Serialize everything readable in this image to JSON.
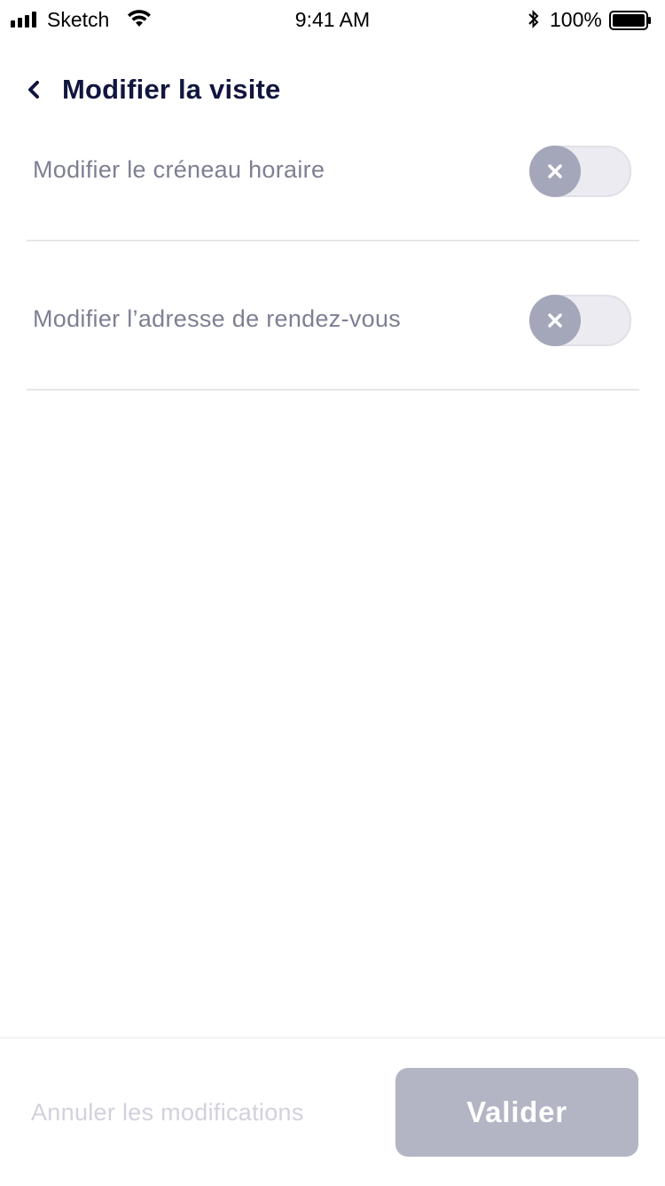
{
  "status_bar": {
    "carrier": "Sketch",
    "time": "9:41 AM",
    "battery_percent": "100%",
    "icons": [
      "signal-icon",
      "wifi-icon",
      "bluetooth-icon",
      "battery-icon"
    ]
  },
  "header": {
    "back_icon": "chevron-left-icon",
    "title": "Modifier la visite"
  },
  "options": [
    {
      "label": "Modifier le créneau horaire",
      "enabled": false,
      "toggle_icon": "close-icon"
    },
    {
      "label": "Modifier l’adresse de rendez-vous",
      "enabled": false,
      "toggle_icon": "close-icon"
    }
  ],
  "footer": {
    "cancel_label": "Annuler les modifications",
    "validate_label": "Valider"
  },
  "colors": {
    "title": "#10163f",
    "label": "#7d7f93",
    "toggle_knob": "#a4a6ba",
    "toggle_track": "#ebebf1",
    "button_disabled": "#b3b5c4",
    "cancel_disabled": "#d1d2dd"
  }
}
